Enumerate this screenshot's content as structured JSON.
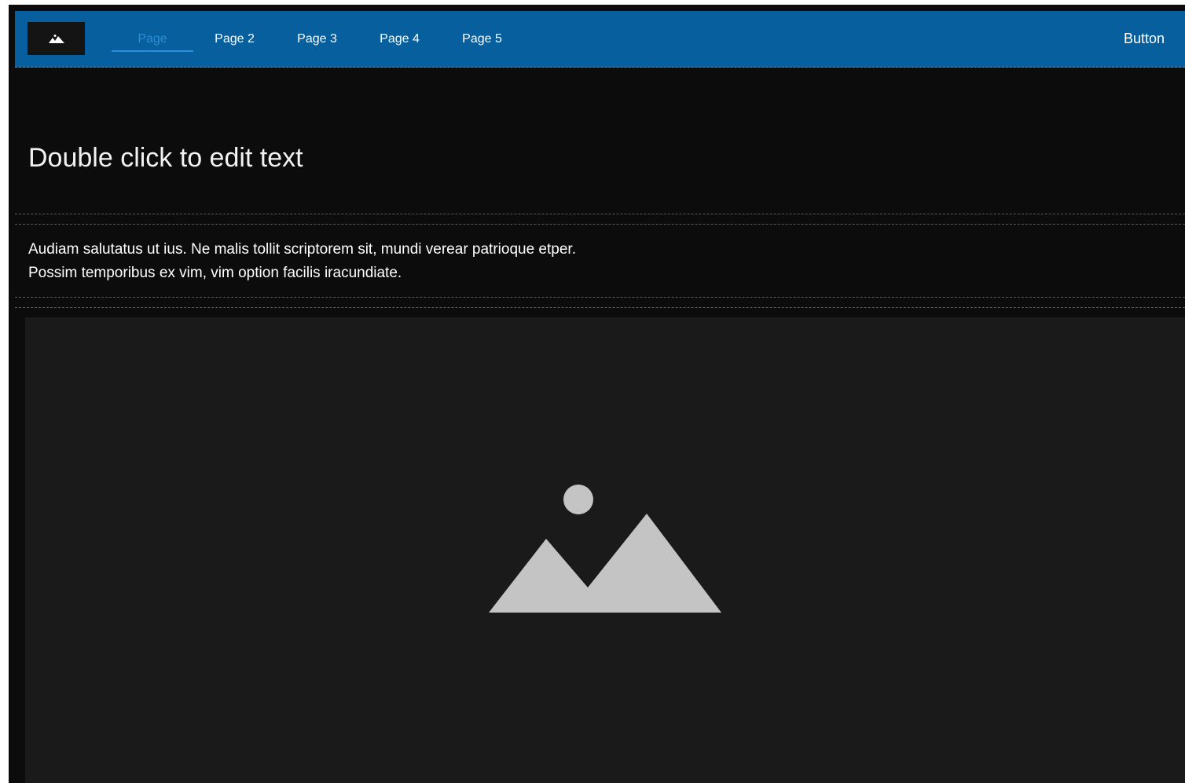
{
  "header": {
    "logo_icon": "mountain-image-icon",
    "nav": [
      {
        "label": "Page",
        "active": true
      },
      {
        "label": "Page 2",
        "active": false
      },
      {
        "label": "Page 3",
        "active": false
      },
      {
        "label": "Page 4",
        "active": false
      },
      {
        "label": "Page 5",
        "active": false
      }
    ],
    "button_label": "Button"
  },
  "hero": {
    "title": "Double click to edit text"
  },
  "text_block": {
    "line1": "Audiam salutatus ut ius. Ne malis tollit scriptorem sit, mundi verear patrioque etper.",
    "line2": "Possim temporibus ex vim, vim option facilis iracundiate."
  },
  "image_section": {
    "icon": "image-placeholder-icon"
  },
  "colors": {
    "header_bg": "#085f9e",
    "active_nav": "#2c8ed8",
    "page_bg": "#0c0c0c",
    "placeholder_bg": "#1a1a1a",
    "placeholder_icon": "#c4c4c4"
  }
}
